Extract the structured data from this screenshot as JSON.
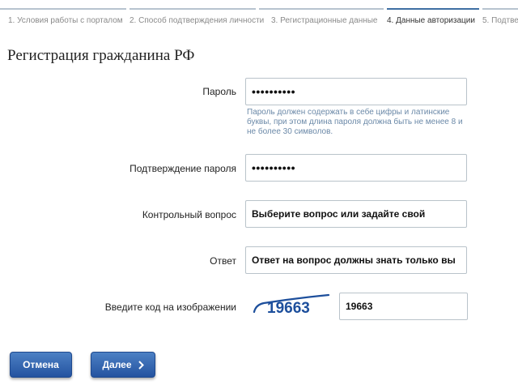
{
  "steps": [
    {
      "label": "1. Условия работы с порталом"
    },
    {
      "label": "2. Способ подтверждения личности"
    },
    {
      "label": "3. Регистрационные данные"
    },
    {
      "label": "4. Данные авторизации"
    },
    {
      "label": "5. Подтве"
    }
  ],
  "active_step": 4,
  "title": "Регистрация гражданина РФ",
  "form": {
    "password": {
      "label": "Пароль",
      "value": "••••••••••"
    },
    "password_hint": "Пароль должен содержать в себе цифры и латинские буквы, при этом длина пароля должна быть не менее 8 и не более 30 символов.",
    "password_confirm": {
      "label": "Подтверждение пароля",
      "value": "••••••••••"
    },
    "security_question": {
      "label": "Контрольный вопрос",
      "value": "Выберите вопрос или задайте свой"
    },
    "answer": {
      "label": "Ответ",
      "value": "Ответ на вопрос должны знать только вы"
    },
    "captcha": {
      "label": "Введите код на изображении",
      "image_text": "19663",
      "value": "19663"
    }
  },
  "buttons": {
    "cancel": "Отмена",
    "next": "Далее"
  },
  "colors": {
    "accent": "#2f5f9e",
    "hint": "#6b89a8",
    "active_step_bar": "#3f6fa3",
    "step_bar": "#b7c3cf"
  },
  "icons": {
    "next": "chevron-right-icon"
  }
}
